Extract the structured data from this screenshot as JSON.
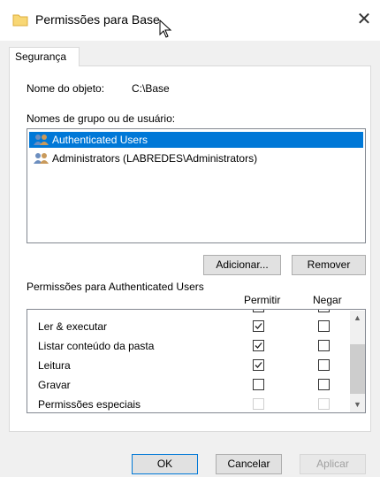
{
  "window": {
    "title": "Permissões para Base"
  },
  "tabs": [
    {
      "label": "Segurança"
    }
  ],
  "object": {
    "label": "Nome do objeto:",
    "value": "C:\\Base"
  },
  "groups": {
    "label": "Nomes de grupo ou de usuário:",
    "items": [
      {
        "label": "Authenticated Users",
        "icon": "users-icon",
        "selected": true
      },
      {
        "label": "Administrators (LABREDES\\Administrators)",
        "icon": "users-icon",
        "selected": false
      }
    ]
  },
  "buttons": {
    "add": "Adicionar...",
    "remove": "Remover",
    "ok": "OK",
    "cancel": "Cancelar",
    "apply": "Aplicar"
  },
  "permissions": {
    "label": "Permissões para Authenticated Users",
    "col_allow": "Permitir",
    "col_deny": "Negar",
    "rows": [
      {
        "label": "Ler & executar",
        "allow": true,
        "deny": false,
        "disabled": false
      },
      {
        "label": "Listar conteúdo da pasta",
        "allow": true,
        "deny": false,
        "disabled": false
      },
      {
        "label": "Leitura",
        "allow": true,
        "deny": false,
        "disabled": false
      },
      {
        "label": "Gravar",
        "allow": false,
        "deny": false,
        "disabled": false
      },
      {
        "label": "Permissões especiais",
        "allow": false,
        "deny": false,
        "disabled": true
      }
    ]
  },
  "colors": {
    "selection": "#0078d7",
    "accent": "#0078d7",
    "folder": "#f8d775"
  }
}
